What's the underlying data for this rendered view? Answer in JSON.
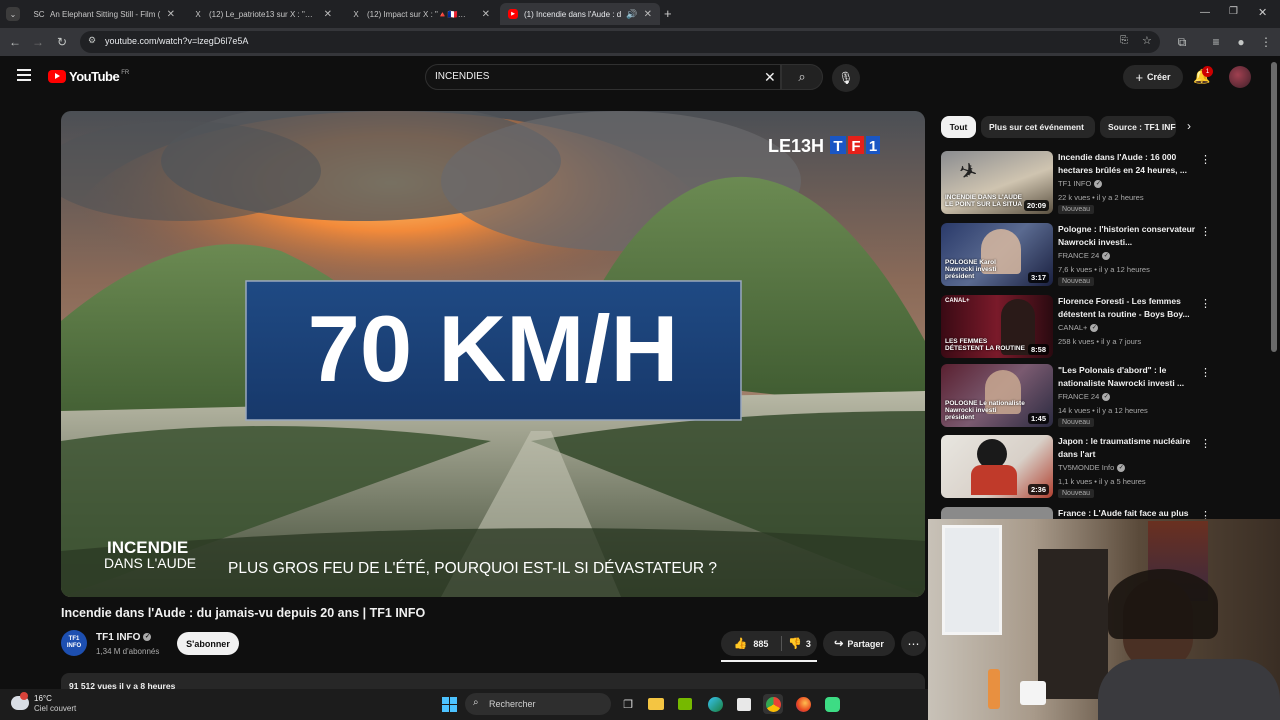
{
  "browser": {
    "tabs": [
      {
        "title": "An Elephant Sitting Still - Film (",
        "favicon": "SC",
        "active": false
      },
      {
        "title": "(12) Le_patriote13 sur X : \"Salle",
        "favicon": "X",
        "active": false
      },
      {
        "title": "(12) Impact sur X : \"🔺🇫🇷🔺🔥",
        "favicon": "X",
        "active": false
      },
      {
        "title": "(1) Incendie dans l'Aude : d",
        "favicon": "▶",
        "active": true
      }
    ],
    "url": "youtube.com/watch?v=lzegD6l7e5A"
  },
  "youtube": {
    "logo_text": "YouTube",
    "region": "FR",
    "search_value": "INCENDIES",
    "create_label": "Créer",
    "notification_count": "1",
    "accent": "#ff0000"
  },
  "player": {
    "channel_mark": "LE13H",
    "tf1_logo": "TF1",
    "headline": "70 KM/H",
    "corner_title_line1": "INCENDIE",
    "corner_title_line2": "DANS L'AUDE",
    "subtitle": "PLUS GROS FEU DE L'ÉTÉ, POURQUOI EST-IL SI DÉVASTATEUR ?"
  },
  "video": {
    "title": "Incendie dans l'Aude : du jamais-vu depuis 20 ans | TF1 INFO",
    "channel": "TF1 INFO",
    "channel_avatar_line1": "TF1",
    "channel_avatar_line2": "INFO",
    "subscribers": "1,34 M d'abonnés",
    "subscribe_label": "S'abonner",
    "likes": "885",
    "dislikes": "3",
    "share_label": "Partager",
    "views_meta": "91 512 vues  il y a 8 heures"
  },
  "sidebar": {
    "chips": [
      {
        "label": "Tout",
        "active": true
      },
      {
        "label": "Plus sur cet événement",
        "active": false
      },
      {
        "label": "Source : TF1 INFO",
        "active": false
      }
    ],
    "recommendations": [
      {
        "title": "Incendie dans l'Aude : 16 000 hectares brûlés en 24 heures, ...",
        "channel": "TF1 INFO",
        "meta": "22 k vues • il y a 2 heures",
        "badge": "Nouveau",
        "duration": "20:09",
        "caption": "INCENDIE DANS L'AUDE LE POINT SUR LA SITUA"
      },
      {
        "title": "Pologne : l'historien conservateur Nawrocki investi...",
        "channel": "FRANCE 24",
        "meta": "7,6 k vues • il y a 12 heures",
        "badge": "Nouveau",
        "duration": "3:17",
        "caption": "POLOGNE Karol Nawrocki investi président"
      },
      {
        "title": "Florence Foresti - Les femmes détestent la routine - Boys Boy...",
        "channel": "CANAL+",
        "meta": "258 k vues • il y a 7 jours",
        "badge": "",
        "duration": "8:58",
        "caption": "LES FEMMES DÉTESTENT LA ROUTINE"
      },
      {
        "title": "\"Les Polonais d'abord\" : le nationaliste Nawrocki investi ...",
        "channel": "FRANCE 24",
        "meta": "14 k vues • il y a 12 heures",
        "badge": "Nouveau",
        "duration": "1:45",
        "caption": "POLOGNE Le nationaliste Nawrocki investi président"
      },
      {
        "title": "Japon : le traumatisme nucléaire dans l'art",
        "channel": "TV5MONDE Info",
        "meta": "1,1 k vues • il y a 5 heures",
        "badge": "Nouveau",
        "duration": "2:36",
        "caption": ""
      },
      {
        "title": "France : L'Aude fait face au plus",
        "channel": "",
        "meta": "",
        "badge": "",
        "duration": "",
        "caption": ""
      }
    ]
  },
  "taskbar": {
    "temperature": "16°C",
    "weather": "Ciel couvert",
    "search_label": "Rechercher"
  }
}
